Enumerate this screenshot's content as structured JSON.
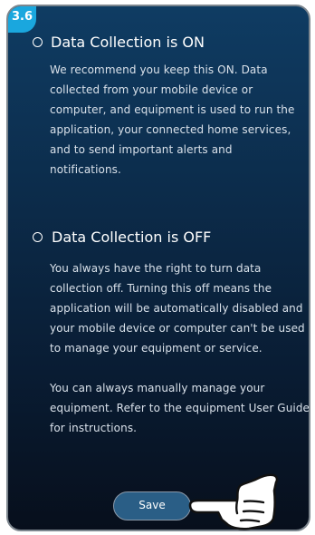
{
  "step_badge": "3.6",
  "options": {
    "on": {
      "title": "Data Collection is ON",
      "body": "We recommend you keep this ON. Data collected from your mobile device or computer, and equipment is used to run the application, your connected home services, and to send important alerts and notifications."
    },
    "off": {
      "title": "Data Collection is OFF",
      "body_1": "You always have the right to turn data collection off. Turning this off means the application will be automatically disabled and your mobile device or computer can't be used to manage your equipment or service.",
      "body_2": "You can always manually manage your equipment. Refer to the equipment User Guide for instructions."
    }
  },
  "save_button": {
    "label": "Save"
  },
  "icons": {
    "pointer": "pointing-hand-icon",
    "radio": "radio-button-icon"
  },
  "colors": {
    "badge": "#1aa7de",
    "panel_top": "#0f3c63",
    "panel_bottom": "#070f1c",
    "button_fill": "#2a5e86"
  }
}
